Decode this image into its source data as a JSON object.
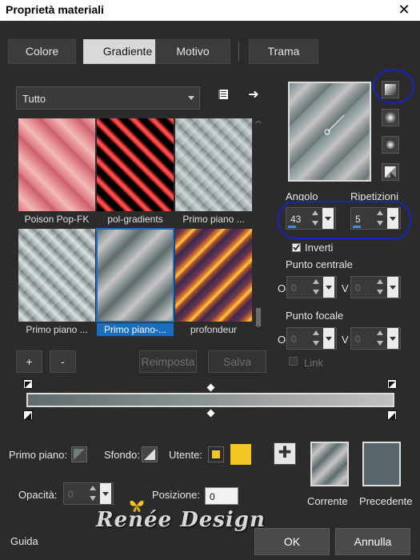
{
  "window": {
    "title": "Proprietà materiali",
    "close_icon": "close-icon"
  },
  "tabs": [
    {
      "label": "Colore",
      "active": false
    },
    {
      "label": "Gradiente",
      "active": true
    },
    {
      "label": "Motivo",
      "active": false
    },
    {
      "label": "Trama",
      "active": false
    }
  ],
  "category": {
    "selected": "Tutto"
  },
  "gallery": [
    {
      "label": "Poison Pop-FK"
    },
    {
      "label": "pol-gradients"
    },
    {
      "label": "Primo piano ..."
    },
    {
      "label": "Primo piano ..."
    },
    {
      "label": "Primo piano-..."
    },
    {
      "label": "profondeur"
    }
  ],
  "gallery_buttons": {
    "add": "+",
    "remove": "-",
    "reset": "Reimposta",
    "save": "Salva"
  },
  "angle": {
    "label": "Angolo",
    "value": "43"
  },
  "repeats": {
    "label": "Ripetizioni",
    "value": "5"
  },
  "invert": {
    "label": "Inverti",
    "checked": true
  },
  "center_point": {
    "label": "Punto centrale",
    "h_label": "O",
    "v_label": "V",
    "h": "0",
    "v": "0"
  },
  "focal_point": {
    "label": "Punto focale",
    "h_label": "O",
    "v_label": "V",
    "h": "0",
    "v": "0"
  },
  "link": {
    "label": "Link",
    "checked": false
  },
  "bottom": {
    "foreground_label": "Primo piano:",
    "background_label": "Sfondo:",
    "user_label": "Utente:",
    "opacity_label": "Opacità:",
    "opacity_value": "0",
    "position_label": "Posizione:",
    "position_value": "0",
    "current_label": "Corrente",
    "previous_label": "Precedente"
  },
  "colors": {
    "accent": "#1a6ec0",
    "user_color": "#f3c623",
    "previous_color": "#56666b",
    "annotation_ring": "#1523c7"
  },
  "watermark": "Renée Design",
  "footer": {
    "help": "Guida",
    "ok": "OK",
    "cancel": "Annulla"
  }
}
